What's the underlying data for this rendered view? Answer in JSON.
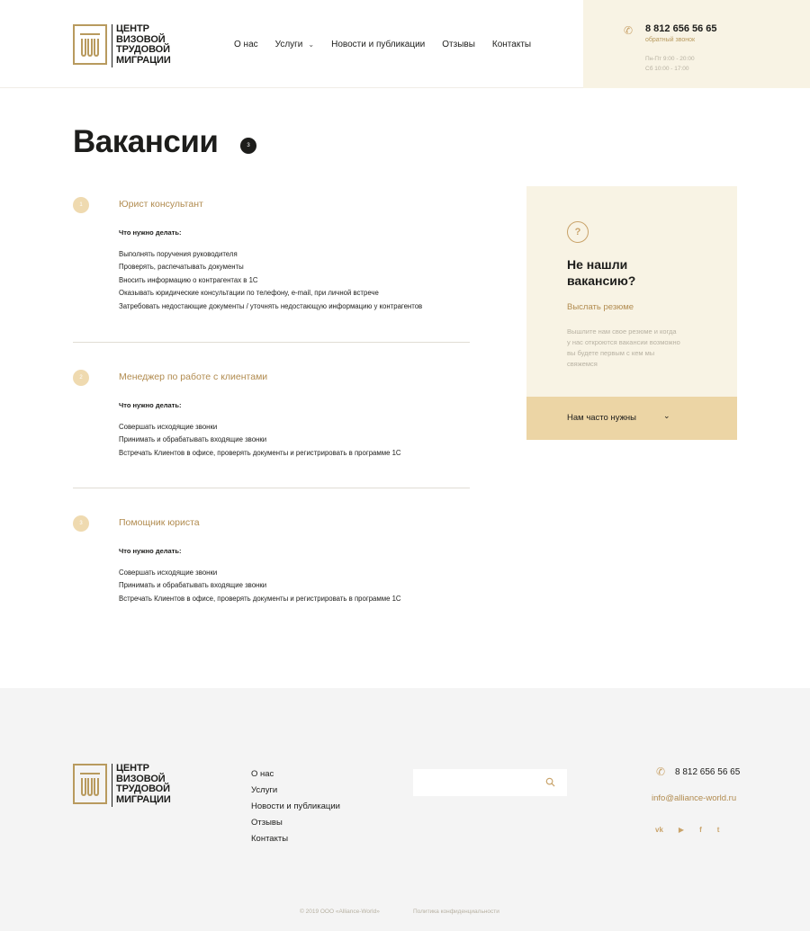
{
  "brand": {
    "logo_lines": [
      "ЦЕНТР",
      "ВИЗОВОЙ",
      "ТРУДОВОЙ",
      "МИГРАЦИИ"
    ],
    "accent_color": "#b18b4f",
    "light_accent": "#f8f3e4"
  },
  "header": {
    "nav": [
      {
        "label": "О нас"
      },
      {
        "label": "Услуги",
        "has_dropdown": true
      },
      {
        "label": "Новости и публикации"
      },
      {
        "label": "Отзывы"
      },
      {
        "label": "Контакты"
      }
    ],
    "phone": "8 812 656 56 65",
    "callback": "обратный звонок",
    "hours": [
      "Пн-Пт 9:00 - 20:00",
      "Сб 10:00 - 17:00"
    ]
  },
  "page": {
    "title": "Вакансии",
    "count": "3"
  },
  "vacancies": [
    {
      "num": "1",
      "title": "Юрист консультант",
      "subtitle": "Что нужно делать:",
      "tasks": [
        "Выполнять поручения руководителя",
        "Проверять, распечатывать документы",
        "Вносить информацию о контрагентах в 1С",
        "Оказывать юридические консультации по телефону, e-mail, при личной встрече",
        "Затребовать недостающие документы / уточнять недостающую информацию у контрагентов"
      ]
    },
    {
      "num": "2",
      "title": "Менеджер по работе с клиентами",
      "subtitle": "Что нужно делать:",
      "tasks": [
        "Совершать исходящие звонки",
        "Принимать и обрабатывать входящие звонки",
        "Встречать Клиентов в офисе, проверять документы и регистрировать в программе 1С"
      ]
    },
    {
      "num": "3",
      "title": "Помощник юриста",
      "subtitle": "Что нужно делать:",
      "tasks": [
        "Совершать исходящие звонки",
        "Принимать и обрабатывать входящие звонки",
        "Встречать Клиентов в офисе, проверять документы и регистрировать в программе 1С"
      ]
    }
  ],
  "sidebar": {
    "icon": "question-icon",
    "title_lines": [
      "Не нашли",
      "вакансию?"
    ],
    "link": "Выслать резюме",
    "text_lines": [
      "Вышлите нам свое резюме и когда",
      "у нас откроются вакансии возможно",
      "вы будете первым с кем мы",
      "свяжемся"
    ],
    "bottom_label": "Нам часто нужны"
  },
  "footer": {
    "nav": [
      "О нас",
      "Услуги",
      "Новости и публикации",
      "Отзывы",
      "Контакты"
    ],
    "search_placeholder": "",
    "phone": "8 812 656 56 65",
    "email": "info@alliance-world.ru",
    "socials": [
      {
        "name": "vk-icon",
        "glyph": "vk"
      },
      {
        "name": "youtube-icon",
        "glyph": "▶"
      },
      {
        "name": "facebook-icon",
        "glyph": "f"
      },
      {
        "name": "twitter-icon",
        "glyph": "t"
      }
    ],
    "copyright": "© 2019 ООО «Alliance-World»",
    "privacy": "Политика конфиденциальности"
  }
}
